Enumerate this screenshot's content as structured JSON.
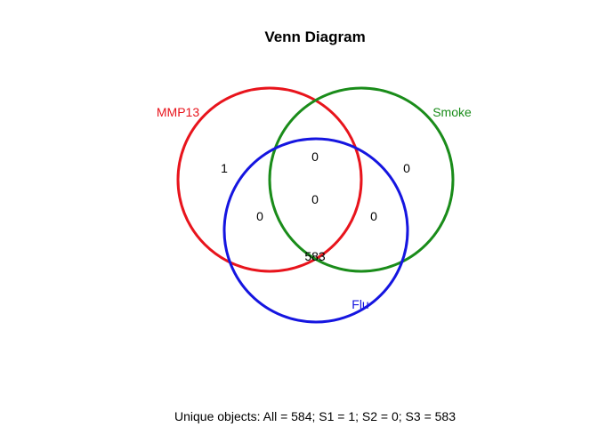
{
  "title": "Venn Diagram",
  "sets": [
    {
      "name": "MMP13",
      "color": "#e8141c"
    },
    {
      "name": "Smoke",
      "color": "#1a8c1a"
    },
    {
      "name": "Flu",
      "color": "#1515e0"
    }
  ],
  "regions": {
    "only_mmp13": "1",
    "only_smoke": "0",
    "only_flu": "583",
    "mmp13_smoke": "0",
    "mmp13_flu": "0",
    "smoke_flu": "0",
    "all_three": "0"
  },
  "footer": "Unique objects: All = 584; S1 = 1; S2 = 0; S3 = 583"
}
